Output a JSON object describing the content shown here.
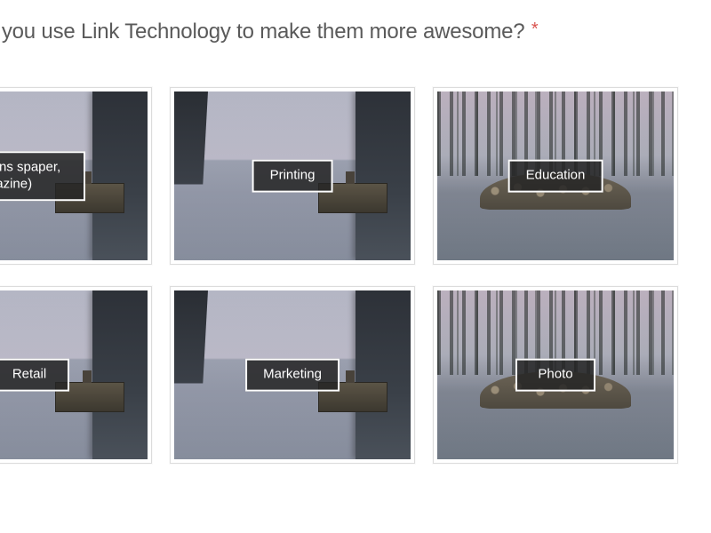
{
  "question": {
    "text_partial": "ill you use Link Technology to make them more awesome?",
    "required_mark": "*"
  },
  "options": [
    {
      "label": "Publications\nspaper, Magazine)",
      "bg": "lake"
    },
    {
      "label": "Printing",
      "bg": "lake"
    },
    {
      "label": "Education",
      "bg": "forest"
    },
    {
      "label": "Retail",
      "bg": "lake"
    },
    {
      "label": "Marketing",
      "bg": "lake"
    },
    {
      "label": "Photo",
      "bg": "forest"
    }
  ]
}
